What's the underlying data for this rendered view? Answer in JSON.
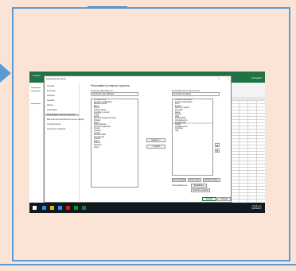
{
  "excel": {
    "ribbon_left": "Archivo",
    "share": "Compartir"
  },
  "dialog": {
    "title": "Opciones de Excel",
    "help": "?",
    "close": "×",
    "nav": [
      "General",
      "Fórmulas",
      "Revisión",
      "Guardar",
      "Idioma",
      "Avanzadas",
      "Personalizar cinta de opciones",
      "Barra de herramientas de acceso rápido",
      "Complementos",
      "Centro de confianza"
    ],
    "nav_selected_index": 6,
    "heading": "Personalice la cinta de opciones.",
    "left_label": "Comandos disponibles en:",
    "left_dropdown": "Comandos más utilizados",
    "right_label": "Personalizar la cinta de opciones:",
    "right_dropdown": "Pestañas principales",
    "left_list": [
      "Actualizar todo",
      "Agregar o quitar filtros",
      "Alinear al centro",
      "Borrar",
      "Buscar",
      "Calcular ahora",
      "Combinar y centrar",
      "Copiar",
      "Cortar",
      "Disminuir tamaño de fuente",
      "Ordenar",
      "Pegar",
      "Tabla dinámica",
      "Formato condicional",
      "Fuente",
      "Guardar",
      "Imprimir",
      "Insertar celdas",
      "Insertar hoja",
      "Nombre",
      "Nuevo",
      "Rehacer",
      "Deshacer",
      "Suma"
    ],
    "right_list": [
      "Pestañas principales",
      "Fondo de eliminación",
      "Inicio",
      "Insertar",
      "Diseño de página",
      "Fórmulas",
      "Datos",
      "Revisar",
      "Vista",
      "Desarrollador",
      "Complementos",
      "Programador",
      "Código",
      "Complementos",
      "Controles",
      "XML"
    ],
    "right_selected_index": 11,
    "add_button": "Agregar >>",
    "remove_button": "<< Quitar",
    "new_tab_button": "Nueva pestaña",
    "new_group_button": "Nuevo grupo",
    "rename_button": "Cambiar nombre...",
    "customizations_label": "Personalizaciones:",
    "restore_button": "Restablecer",
    "import_export_button": "Importar o exportar",
    "ok_button": "Aceptar",
    "cancel_button": "Cancelar"
  },
  "taskbar": {
    "time": "10:16 a.m.",
    "date": "13/05/2017"
  },
  "colors": {
    "excel_green": "#217346",
    "frame_blue": "#5b9bd5",
    "slide_bg": "#fbe4d5"
  }
}
